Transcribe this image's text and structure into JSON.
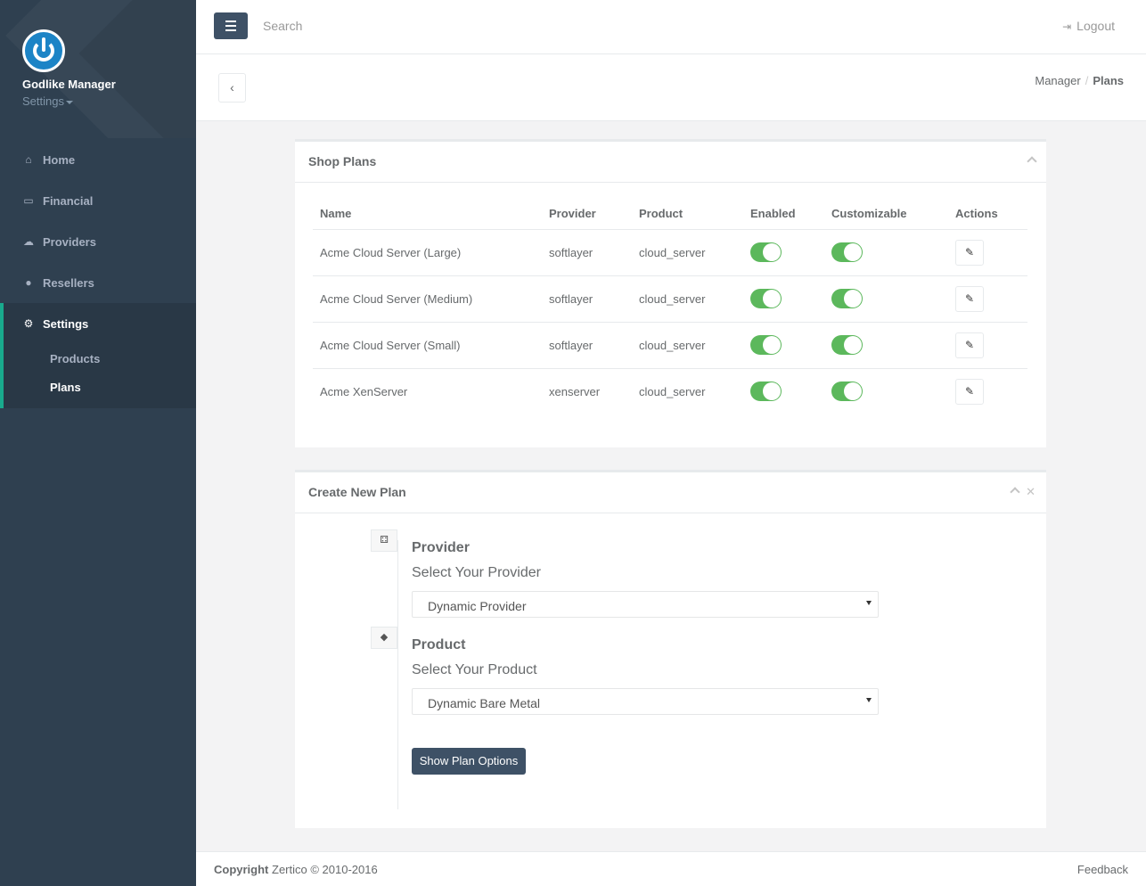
{
  "profile": {
    "name": "Godlike Manager",
    "sub": "Settings"
  },
  "sidebar": {
    "items": [
      {
        "label": "Home",
        "icon": "home-icon"
      },
      {
        "label": "Financial",
        "icon": "credit-card-icon"
      },
      {
        "label": "Providers",
        "icon": "cloud-icon"
      },
      {
        "label": "Resellers",
        "icon": "user-icon"
      }
    ],
    "active": {
      "label": "Settings",
      "icon": "gear-icon"
    },
    "subitems": [
      {
        "label": "Products"
      },
      {
        "label": "Plans"
      }
    ]
  },
  "topbar": {
    "search_placeholder": "Search",
    "logout_label": "Logout"
  },
  "breadcrumb": {
    "parent": "Manager",
    "current": "Plans"
  },
  "shop_plans": {
    "title": "Shop Plans",
    "columns": [
      "Name",
      "Provider",
      "Product",
      "Enabled",
      "Customizable",
      "Actions"
    ],
    "rows": [
      {
        "name": "Acme Cloud Server (Large)",
        "provider": "softlayer",
        "product": "cloud_server",
        "enabled": true,
        "customizable": true
      },
      {
        "name": "Acme Cloud Server (Medium)",
        "provider": "softlayer",
        "product": "cloud_server",
        "enabled": true,
        "customizable": true
      },
      {
        "name": "Acme Cloud Server (Small)",
        "provider": "softlayer",
        "product": "cloud_server",
        "enabled": true,
        "customizable": true
      },
      {
        "name": "Acme XenServer",
        "provider": "xenserver",
        "product": "cloud_server",
        "enabled": true,
        "customizable": true
      }
    ]
  },
  "create_plan": {
    "title": "Create New Plan",
    "provider": {
      "heading": "Provider",
      "label": "Select Your Provider",
      "selected": "Dynamic Provider"
    },
    "product": {
      "heading": "Product",
      "label": "Select Your Product",
      "selected": "Dynamic Bare Metal"
    },
    "button_label": "Show Plan Options"
  },
  "footer": {
    "copyright_label": "Copyright",
    "copyright_text": "Zertico © 2010-2016",
    "feedback": "Feedback"
  },
  "colors": {
    "sidebar": "#2f4050",
    "accent": "#19aa8d",
    "primary_button": "#3e5166",
    "toggle_on": "#5cb85c"
  }
}
